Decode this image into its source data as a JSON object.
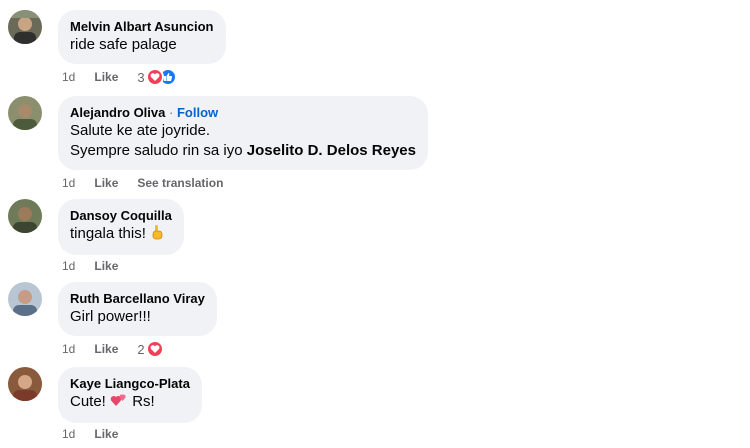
{
  "comments": [
    {
      "author": "Melvin Albart Asuncion",
      "lines": [
        "ride safe palage"
      ],
      "time": "1d",
      "like": "Like",
      "reaction_count": "3",
      "reactions": [
        "heart-icon",
        "thumbs-up-icon"
      ]
    },
    {
      "author": "Alejandro Oliva",
      "separator": "·",
      "follow": "Follow",
      "lines": [
        "Salute ke ate joyride."
      ],
      "line2_prefix": "Syempre saludo rin sa iyo ",
      "mention": "Joselito D. Delos Reyes",
      "time": "1d",
      "like": "Like",
      "see_translation": "See translation"
    },
    {
      "author": "Dansoy Coquilla",
      "text_prefix": "tingala this! ",
      "emoji": "pointing-up-icon",
      "time": "1d",
      "like": "Like"
    },
    {
      "author": "Ruth Barcellano Viray",
      "lines": [
        "Girl power!!!"
      ],
      "time": "1d",
      "like": "Like",
      "reaction_count": "2",
      "reactions": [
        "heart-icon"
      ]
    },
    {
      "author": "Kaye Liangco-Plata",
      "text_prefix": "Cute! ",
      "emoji": "two-hearts-icon",
      "text_suffix": " Rs!",
      "time": "1d",
      "like": "Like"
    }
  ],
  "colors": {
    "bubble": "#f0f2f5",
    "link": "#0064d1",
    "meta": "#65676b",
    "heart": "#f33e58",
    "like": "#1877f2"
  }
}
